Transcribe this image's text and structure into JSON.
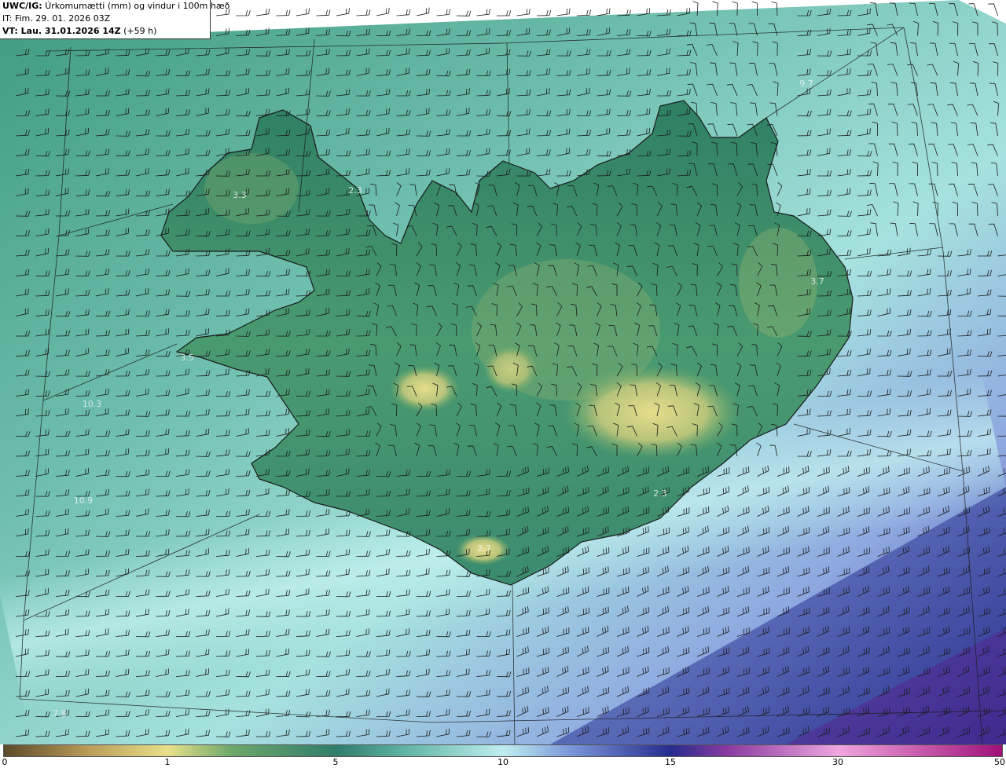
{
  "header": {
    "model_prefix": "UWC/IG:",
    "title": "Úrkomumætti (mm) og vindur i 100m hæð",
    "init_time": "IT: Fim. 29. 01. 2026 03Z",
    "valid_prefix": "VT: Lau. 31.01.2026 14Z",
    "valid_suffix": "(+59 h)"
  },
  "colorbar": {
    "unit": "mm",
    "ticks": [
      "0",
      "1",
      "5",
      "10",
      "15",
      "30",
      "50"
    ],
    "stops": [
      {
        "value": 0,
        "color": "#5b4a2a"
      },
      {
        "value": 0.5,
        "color": "#b89a58"
      },
      {
        "value": 1,
        "color": "#e8e08a"
      },
      {
        "value": 2.5,
        "color": "#6ea86a"
      },
      {
        "value": 5,
        "color": "#2f7d6a"
      },
      {
        "value": 7,
        "color": "#5fb3a2"
      },
      {
        "value": 10,
        "color": "#bfeef0"
      },
      {
        "value": 12,
        "color": "#7a96d8"
      },
      {
        "value": 15,
        "color": "#262c8e"
      },
      {
        "value": 20,
        "color": "#8a3aa0"
      },
      {
        "value": 30,
        "color": "#f0a6de"
      },
      {
        "value": 50,
        "color": "#a0127a"
      }
    ]
  },
  "map_values": [
    {
      "name": "value-westfjords",
      "text": "3.3"
    },
    {
      "name": "value-northwest-coast",
      "text": "2.3"
    },
    {
      "name": "value-northeast-sea",
      "text": "9.7"
    },
    {
      "name": "value-east",
      "text": "3.7"
    },
    {
      "name": "value-snaefellsnes",
      "text": "3.5"
    },
    {
      "name": "value-west-sea",
      "text": "10.3"
    },
    {
      "name": "value-southwest-sea",
      "text": "10.9"
    },
    {
      "name": "value-vatnajokull-south",
      "text": "2.3"
    },
    {
      "name": "value-myrdalsjokull",
      "text": "2.7"
    },
    {
      "name": "value-bottom-left",
      "text": "7.8"
    }
  ],
  "colors": {
    "land_bg": "#3d8a72",
    "sea_bg": "#7cc7b8",
    "coast": "#1a1a1a",
    "wind_barb": "#1a1a1a"
  }
}
